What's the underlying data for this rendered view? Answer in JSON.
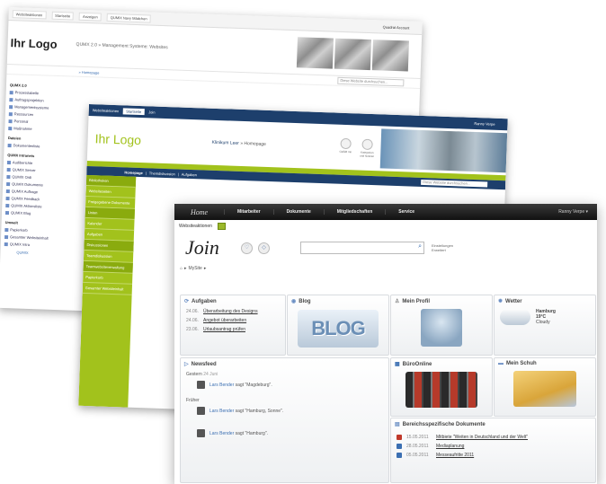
{
  "back": {
    "tabs": [
      "Websiteaktionen",
      "Startseite",
      "Anzeigen",
      "QUMIX Navy Mädchen"
    ],
    "user": "Quadrat Account",
    "logo": "Ihr Logo",
    "breadcrumb": "QUMX 2.0 » Management Systeme: Websites",
    "homelink": "» Homepage",
    "search_placeholder": "Diese Website durchsuchen...",
    "left_head": "QUMX 2.0",
    "left_items": [
      "Prozesstabelle",
      "Auftragsprojektion",
      "Managementsysteme",
      "Ressourcen",
      "Personal",
      "Maßnahme"
    ],
    "left_head2": "Dateien",
    "left_items2": [
      "Dokumentenliste"
    ],
    "left_head3": "QUMX Intranets",
    "left_items3": [
      "Audiberichte",
      "QUMIX Server",
      "QUMIX Ordi",
      "QUMIX Dokumente",
      "QUMIX Auftrage",
      "QUMIX Feedback",
      "QUMIX Aktionsliste",
      "QUMIX Blog"
    ],
    "left_head4": "Umwelt",
    "left_items4": [
      "Papierkorb",
      "Gesamter Websiteinhalt",
      "QUMIX Intra"
    ],
    "footer": "QUMIX"
  },
  "middle": {
    "top": [
      "Websiteaktionen",
      "Startseite",
      "Join"
    ],
    "user": "Ranny Verpe",
    "logo": "Ihr Logo",
    "crumb_site": "Klinikum Leer",
    "crumb_page": "» Homepage",
    "icons": [
      "Gefällt mir",
      "Kategorien und Notizen"
    ],
    "nav": [
      "Homepage",
      "Themdiskussion",
      "Aufgaben"
    ],
    "search_placeholder": "Diese Website durchsuchen...",
    "leftnav": [
      "Bibliotheken",
      "Websiteseiten",
      "Freigegebene Dokumente",
      "Listen",
      "Kalender",
      "Aufgaben",
      "Diskussionen",
      "Teamdiskussion",
      "Teamwebsiteverwaltung",
      "Papierkorb",
      "Gesamter Websiteinhalt"
    ]
  },
  "front": {
    "nav": {
      "home": "Home",
      "links": [
        "Mitarbeiter",
        "Dokumente",
        "Mitgliedschaften",
        "Service"
      ],
      "user": "Ranny Verpe ▾"
    },
    "actions": "Websiteaktionen",
    "brand": "Join",
    "search_links": [
      "Einstellungen",
      "Erweitert"
    ],
    "breadcrumb": "MySite",
    "tasks": {
      "title": "Aufgaben",
      "items": [
        {
          "date": "24.06.",
          "text": "Überarbeitung des Designs"
        },
        {
          "date": "24.06.",
          "text": "Angebot überarbeiten"
        },
        {
          "date": "23.06.",
          "text": "Urlaubsantrag prüfen"
        }
      ]
    },
    "blog": {
      "title": "Blog",
      "image_text": "BLOG"
    },
    "profile": {
      "title": "Mein Profil"
    },
    "weather": {
      "title": "Wetter",
      "city": "Hamburg",
      "temp": "19°C",
      "cond": "Cloudy"
    },
    "newsfeed": {
      "title": "Newsfeed",
      "yesterday": "Gestern",
      "yesterday_date": "24 Juni",
      "early": "Früher",
      "posts": [
        {
          "name": "Lars Bender",
          "text": "sagt \"Magdeburg\"."
        },
        {
          "name": "Lars Bender",
          "text": "sagt \"Hamburg, Sonne\"."
        },
        {
          "name": "Lars Bender",
          "text": "sagt \"Hamburg\"."
        }
      ]
    },
    "office": {
      "title": "BüroOnline"
    },
    "drawer": {
      "title": "Mein Schuh"
    },
    "docs": {
      "title": "Bereichsspezifische Dokumente",
      "items": [
        {
          "date": "15.05.2011",
          "text": "Mitbiete \"Weiten in Deutschland und der Welt\"",
          "color": "#c0392b"
        },
        {
          "date": "28.05.2011",
          "text": "Mediaplanung",
          "color": "#3b6fb2"
        },
        {
          "date": "05.05.2011",
          "text": "Messeaufritte 2011",
          "color": "#3b6fb2"
        }
      ]
    }
  }
}
